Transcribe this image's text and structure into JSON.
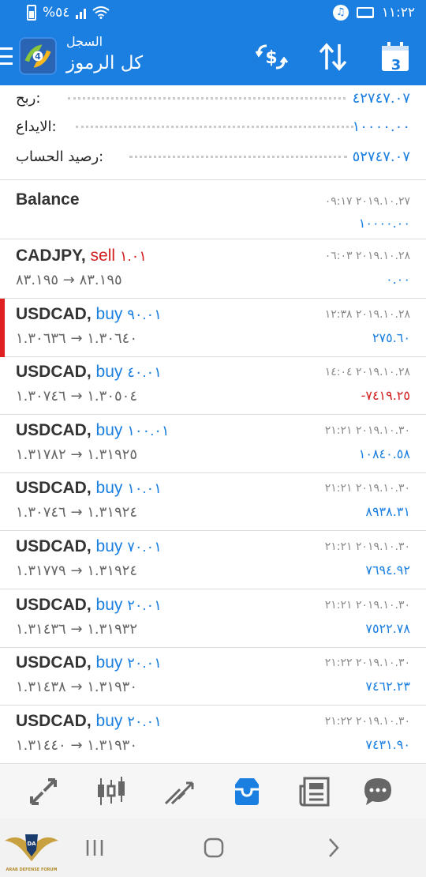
{
  "status_bar": {
    "time": "١١:٢٢",
    "battery_text": "%٥٤",
    "icons": [
      "battery-icon",
      "signal-icon",
      "wifi-icon",
      "music-icon",
      "laptop-icon"
    ]
  },
  "app_bar": {
    "subtitle": "السجل",
    "title": "كل الرموز",
    "calendar_day": "3",
    "icons": [
      "menu-icon",
      "metatrader-logo",
      "currency-exchange-icon",
      "sort-icon",
      "calendar-icon"
    ]
  },
  "summary": {
    "profit_label": "ربح:",
    "profit_value": "٤٢٧٤٧.٠٧",
    "deposit_label": "الايداع:",
    "deposit_value": "١٠٠٠٠.٠٠",
    "balance_label": "رصيد الحساب:",
    "balance_value": "٥٢٧٤٧.٠٧"
  },
  "balance_entry": {
    "label": "Balance",
    "time": "٢٠١٩.١٠.٢٧ ٠٩:١٧",
    "amount": "١٠٠٠٠.٠٠"
  },
  "deals": [
    {
      "symbol": "CADJPY,",
      "side": "sell",
      "volume": "١.٠١",
      "prices": "٨٣.١٩٥ → ٨٣.١٩٥",
      "time": "٢٠١٩.١٠.٢٨ ٠٦:٠٣",
      "profit": "٠.٠٠",
      "negative": false,
      "highlight": false
    },
    {
      "symbol": "USDCAD,",
      "side": "buy",
      "volume": "٩٠.٠١",
      "prices": "١.٣٠٦٤٠ → ١.٣٠٦٣٦",
      "time": "٢٠١٩.١٠.٢٨ ١٢:٣٨",
      "profit": "٢٧٥.٦٠",
      "negative": false,
      "highlight": true
    },
    {
      "symbol": "USDCAD,",
      "side": "buy",
      "volume": "٤٠.٠١",
      "prices": "١.٣٠٥٠٤ → ١.٣٠٧٤٦",
      "time": "٢٠١٩.١٠.٢٨ ١٤:٠٤",
      "profit": "-٧٤١٩.٢٥",
      "negative": true,
      "highlight": false
    },
    {
      "symbol": "USDCAD,",
      "side": "buy",
      "volume": "١٠٠.٠١",
      "prices": "١.٣١٩٢٥ → ١.٣١٧٨٢",
      "time": "٢٠١٩.١٠.٣٠ ٢١:٢١",
      "profit": "١٠٨٤٠.٥٨",
      "negative": false,
      "highlight": false
    },
    {
      "symbol": "USDCAD,",
      "side": "buy",
      "volume": "١٠.٠١",
      "prices": "١.٣١٩٢٤ → ١.٣٠٧٤٦",
      "time": "٢٠١٩.١٠.٣٠ ٢١:٢١",
      "profit": "٨٩٣٨.٣١",
      "negative": false,
      "highlight": false
    },
    {
      "symbol": "USDCAD,",
      "side": "buy",
      "volume": "٧٠.٠١",
      "prices": "١.٣١٩٢٤ → ١.٣١٧٧٩",
      "time": "٢٠١٩.١٠.٣٠ ٢١:٢١",
      "profit": "٧٦٩٤.٩٢",
      "negative": false,
      "highlight": false
    },
    {
      "symbol": "USDCAD,",
      "side": "buy",
      "volume": "٢٠.٠١",
      "prices": "١.٣١٩٣٢ → ١.٣١٤٣٦",
      "time": "٢٠١٩.١٠.٣٠ ٢١:٢١",
      "profit": "٧٥٢٢.٧٨",
      "negative": false,
      "highlight": false
    },
    {
      "symbol": "USDCAD,",
      "side": "buy",
      "volume": "٢٠.٠١",
      "prices": "١.٣١٩٣٠ → ١.٣١٤٣٨",
      "time": "٢٠١٩.١٠.٣٠ ٢١:٢٢",
      "profit": "٧٤٦٢.٢٣",
      "negative": false,
      "highlight": false
    },
    {
      "symbol": "USDCAD,",
      "side": "buy",
      "volume": "٢٠.٠١",
      "prices": "١.٣١٩٣٠ → ١.٣١٤٤٠",
      "time": "٢٠١٩.١٠.٣٠ ٢١:٢٢",
      "profit": "٧٤٣١.٩٠",
      "negative": false,
      "highlight": false
    }
  ],
  "bottom_nav": {
    "items": [
      "quotes-icon",
      "chart-icon",
      "trade-icon",
      "history-icon",
      "news-icon",
      "chat-icon"
    ],
    "active": "history-icon"
  },
  "system_nav": {
    "items": [
      "recent-apps-icon",
      "home-icon",
      "back-icon"
    ]
  },
  "watermark": {
    "text": "ARAB DEFENSE FORUM",
    "logo_letters": "DA"
  },
  "colors": {
    "primary": "#1a7fe0",
    "buy": "#1a7fe0",
    "sell": "#d22020",
    "negative": "#d22020"
  }
}
